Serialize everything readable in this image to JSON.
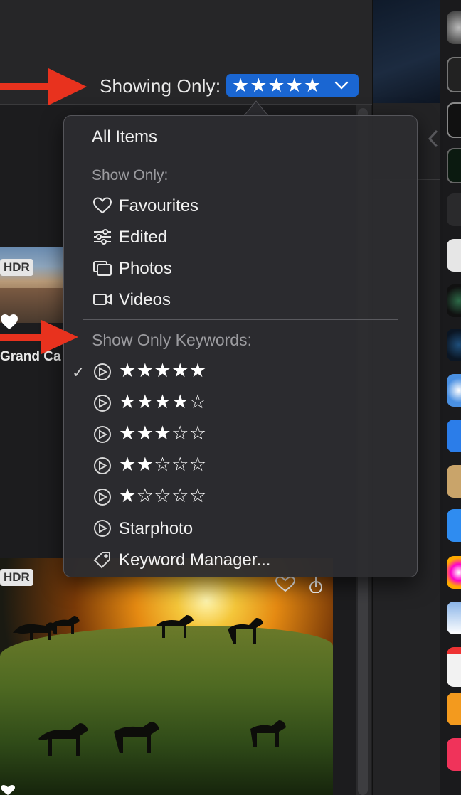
{
  "toolbar": {
    "showing_label": "Showing Only:",
    "filter_value": "★★★★★"
  },
  "grid": {
    "thumb1_badge": "HDR",
    "thumb1_title": "Grand Ca",
    "thumb2_badge": "HDR"
  },
  "menu": {
    "all_items": "All Items",
    "show_only_header": "Show Only:",
    "show_only": [
      {
        "label": "Favourites",
        "icon": "heart-icon"
      },
      {
        "label": "Edited",
        "icon": "sliders-icon"
      },
      {
        "label": "Photos",
        "icon": "photos-icon"
      },
      {
        "label": "Videos",
        "icon": "video-icon"
      }
    ],
    "keywords_header": "Show Only Keywords:",
    "keywords": [
      {
        "label": "★★★★★",
        "checked": true,
        "icon": "keyword-gear-icon"
      },
      {
        "label": "★★★★☆",
        "checked": false,
        "icon": "keyword-gear-icon"
      },
      {
        "label": "★★★☆☆",
        "checked": false,
        "icon": "keyword-gear-icon"
      },
      {
        "label": "★★☆☆☆",
        "checked": false,
        "icon": "keyword-gear-icon"
      },
      {
        "label": "★☆☆☆☆",
        "checked": false,
        "icon": "keyword-gear-icon"
      },
      {
        "label": "Starphoto",
        "checked": false,
        "icon": "keyword-gear-icon"
      }
    ],
    "keyword_manager": "Keyword Manager...",
    "check_glyph": "✓"
  },
  "colors": {
    "accent": "#1a66d2",
    "annotation_arrow": "#e8321e"
  }
}
